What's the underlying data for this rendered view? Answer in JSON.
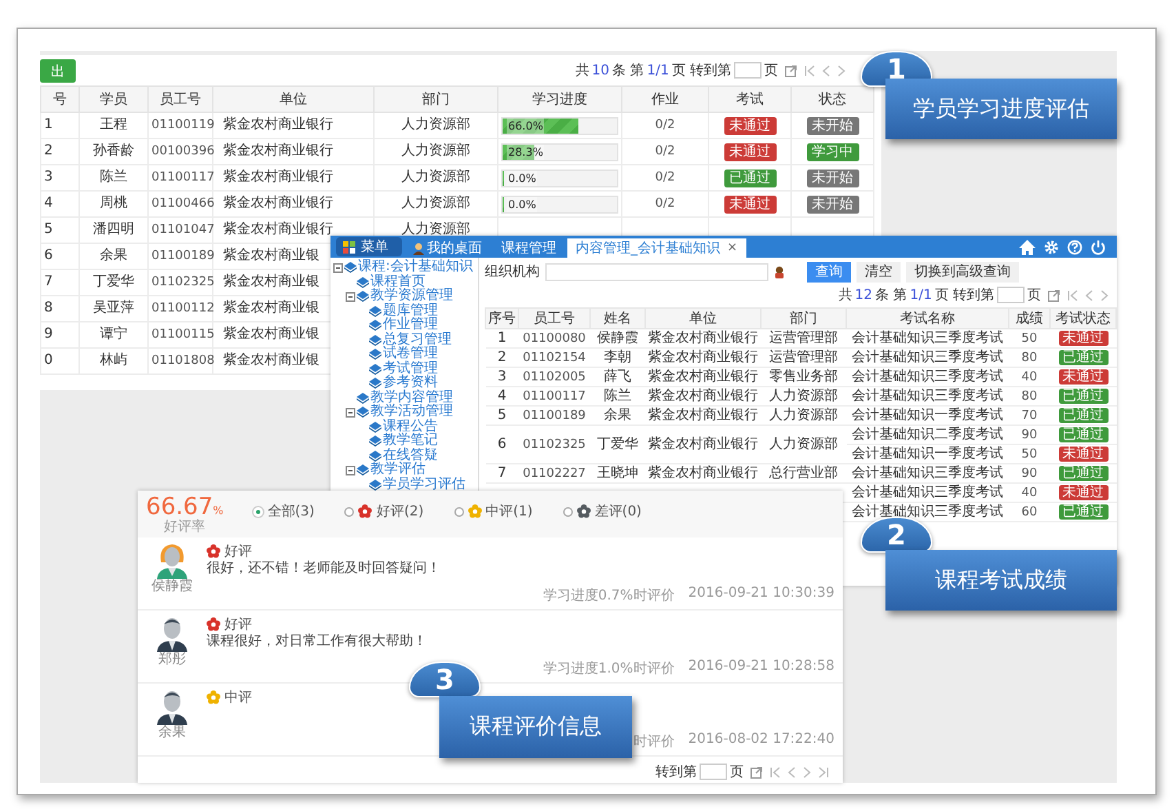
{
  "progress_panel": {
    "export_button": "出",
    "pagination": {
      "parts": [
        {
          "text": "共",
          "highlight": false
        },
        {
          "text": "10",
          "highlight": true
        },
        {
          "text": "条 第",
          "highlight": false
        },
        {
          "text": "1/1",
          "highlight": true
        },
        {
          "text": "页 转到第",
          "highlight": false
        }
      ],
      "unit": "页"
    },
    "columns": [
      "号",
      "学员",
      "员工号",
      "单位",
      "部门",
      "学习进度",
      "作业",
      "考试",
      "状态"
    ],
    "rows": [
      {
        "seq": "1",
        "name": "王程",
        "id": "01100119",
        "unit": "紫金农村商业银行",
        "dept": "人力资源部",
        "progress": {
          "level": 0.66,
          "label": "66.0%"
        },
        "homework": "0/2",
        "exam": {
          "label": "未通过",
          "passed": false
        },
        "status": {
          "label": "未开始",
          "kind": "not_started"
        }
      },
      {
        "seq": "2",
        "name": "孙香龄",
        "id": "00100396",
        "unit": "紫金农村商业银行",
        "dept": "人力资源部",
        "progress": {
          "level": 0.28,
          "label": "28.3%"
        },
        "homework": "0/2",
        "exam": {
          "label": "未通过",
          "passed": false
        },
        "status": {
          "label": "学习中",
          "kind": "learning"
        }
      },
      {
        "seq": "3",
        "name": "陈兰",
        "id": "01100117",
        "unit": "紫金农村商业银行",
        "dept": "人力资源部",
        "progress": {
          "level": 0,
          "label": "0.0%"
        },
        "homework": "0/2",
        "exam": {
          "label": "已通过",
          "passed": true
        },
        "status": {
          "label": "未开始",
          "kind": "not_started"
        }
      },
      {
        "seq": "4",
        "name": "周桃",
        "id": "01100466",
        "unit": "紫金农村商业银行",
        "dept": "人力资源部",
        "progress": {
          "level": 0,
          "label": "0.0%"
        },
        "homework": "0/2",
        "exam": {
          "label": "未通过",
          "passed": false
        },
        "status": {
          "label": "未开始",
          "kind": "not_started"
        }
      },
      {
        "seq": "5",
        "name": "潘四明",
        "id": "01101047",
        "unit": "紫金农村商业银行",
        "dept": "人力资源部"
      },
      {
        "seq": "6",
        "name": "余果",
        "id": "01100189",
        "unit": "紫金农村商业银"
      },
      {
        "seq": "7",
        "name": "丁爱华",
        "id": "01102325",
        "unit": "紫金农村商业银"
      },
      {
        "seq": "8",
        "name": "吴亚萍",
        "id": "01100112",
        "unit": "紫金农村商业银"
      },
      {
        "seq": "9",
        "name": "谭宁",
        "id": "01100115",
        "unit": "紫金农村商业银"
      },
      {
        "seq": "0",
        "name": "林屿",
        "id": "01101808",
        "unit": "紫金农村商业银"
      }
    ]
  },
  "exam_window": {
    "menu_button": "菜单",
    "tabs": [
      {
        "label": "我的桌面",
        "selected": false,
        "kind": "desk"
      },
      {
        "label": "课程管理",
        "selected": false,
        "kind": "plain"
      },
      {
        "label": "内容管理_会计基础知识",
        "selected": true,
        "kind": "plain",
        "close": "×"
      }
    ],
    "tree": [
      {
        "label": "课程:会计基础知识",
        "children": [
          {
            "label": "课程首页"
          },
          {
            "label": "教学资源管理",
            "children": [
              {
                "label": "题库管理"
              },
              {
                "label": "作业管理"
              },
              {
                "label": "总复习管理"
              },
              {
                "label": "试卷管理"
              },
              {
                "label": "考试管理"
              },
              {
                "label": "参考资料"
              }
            ]
          },
          {
            "label": "教学内容管理"
          },
          {
            "label": "教学活动管理",
            "children": [
              {
                "label": "课程公告"
              },
              {
                "label": "教学笔记"
              },
              {
                "label": "在线答疑"
              }
            ]
          },
          {
            "label": "教学评估",
            "children": [
              {
                "label": "学员学习评估"
              }
            ]
          }
        ]
      }
    ],
    "org_label": "组织机构",
    "buttons": [
      {
        "label": "查询",
        "primary": true
      },
      {
        "label": "清空",
        "primary": false
      },
      {
        "label": "切换到高级查询",
        "primary": false
      }
    ],
    "pagination": {
      "parts": [
        {
          "text": "共",
          "highlight": false
        },
        {
          "text": "12",
          "highlight": true
        },
        {
          "text": "条 第",
          "highlight": false
        },
        {
          "text": "1/1",
          "highlight": true
        },
        {
          "text": "页 转到第",
          "highlight": false
        }
      ],
      "unit": "页"
    },
    "columns": [
      "序号",
      "员工号",
      "姓名",
      "单位",
      "部门",
      "考试名称",
      "成绩",
      "考试状态"
    ],
    "rows": [
      {
        "seq": "1",
        "id": "01100080",
        "name": "侯静霞",
        "unit": "紫金农村商业银行",
        "dept": "运营管理部",
        "exams": [
          {
            "title": "会计基础知识三季度考试",
            "score": "50",
            "label": "未通过",
            "passed": false
          }
        ]
      },
      {
        "seq": "2",
        "id": "01102154",
        "name": "李朝",
        "unit": "紫金农村商业银行",
        "dept": "运营管理部",
        "exams": [
          {
            "title": "会计基础知识三季度考试",
            "score": "80",
            "label": "已通过",
            "passed": true
          }
        ]
      },
      {
        "seq": "3",
        "id": "01102005",
        "name": "薛飞",
        "unit": "紫金农村商业银行",
        "dept": "零售业务部",
        "exams": [
          {
            "title": "会计基础知识三季度考试",
            "score": "40",
            "label": "未通过",
            "passed": false
          }
        ]
      },
      {
        "seq": "4",
        "id": "01100117",
        "name": "陈兰",
        "unit": "紫金农村商业银行",
        "dept": "人力资源部",
        "exams": [
          {
            "title": "会计基础知识三季度考试",
            "score": "80",
            "label": "已通过",
            "passed": true
          }
        ]
      },
      {
        "seq": "5",
        "id": "01100189",
        "name": "余果",
        "unit": "紫金农村商业银行",
        "dept": "人力资源部",
        "exams": [
          {
            "title": "会计基础知识一季度考试",
            "score": "70",
            "label": "已通过",
            "passed": true
          }
        ]
      },
      {
        "seq": "6",
        "id": "01102325",
        "name": "丁爱华",
        "unit": "紫金农村商业银行",
        "dept": "人力资源部",
        "exams": [
          {
            "title": "会计基础知识二季度考试",
            "score": "90",
            "label": "已通过",
            "passed": true
          },
          {
            "title": "会计基础知识一季度考试",
            "score": "50",
            "label": "未通过",
            "passed": false
          }
        ]
      },
      {
        "seq": "7",
        "id": "01102227",
        "name": "王晓坤",
        "unit": "紫金农村商业银行",
        "dept": "总行营业部",
        "exams": [
          {
            "title": "会计基础知识三季度考试",
            "score": "90",
            "label": "已通过",
            "passed": true
          }
        ]
      },
      {
        "exams": [
          {
            "title": "会计基础知识三季度考试",
            "score": "40",
            "label": "未通过",
            "passed": false
          }
        ]
      },
      {
        "exams": [
          {
            "title": "会计基础知识三季度考试",
            "score": "60",
            "label": "已通过",
            "passed": true
          }
        ]
      }
    ]
  },
  "review_panel": {
    "rate": "66.67",
    "rate_unit": "%",
    "rate_label": "好评率",
    "filters": [
      {
        "label": "全部(3)",
        "selected": true,
        "kind": "all"
      },
      {
        "label": "好评(2)",
        "selected": false,
        "kind": "good"
      },
      {
        "label": "中评(1)",
        "selected": false,
        "kind": "medium"
      },
      {
        "label": "差评(0)",
        "selected": false,
        "kind": "bad"
      }
    ],
    "reviews": [
      {
        "name": "侯静霞",
        "avatar": {
          "kind": "female"
        },
        "rating": {
          "label": "好评",
          "kind": "good"
        },
        "comment": "很好，还不错！老师能及时回答疑问！",
        "progress_note": "学习进度0.7%时评价",
        "time": "2016-09-21 10:30:39"
      },
      {
        "name": "郑彤",
        "avatar": {
          "kind": "male"
        },
        "rating": {
          "label": "好评",
          "kind": "good"
        },
        "comment": "课程很好，对日常工作有很大帮助！",
        "progress_note": "学习进度1.0%时评价",
        "time": "2016-09-21 10:28:58"
      },
      {
        "name": "余果",
        "avatar": {
          "kind": "male"
        },
        "rating": {
          "label": "中评",
          "kind": "medium"
        },
        "progress_note": "时评价",
        "time": "2016-08-02 17:22:40"
      }
    ],
    "pagination": {
      "goto": "转到第",
      "unit": "页"
    }
  },
  "callouts": [
    {
      "number": "1",
      "text": "学员学习进度评估"
    },
    {
      "number": "2",
      "text": "课程考试成绩"
    },
    {
      "number": "3",
      "text": "课程评价信息"
    }
  ]
}
